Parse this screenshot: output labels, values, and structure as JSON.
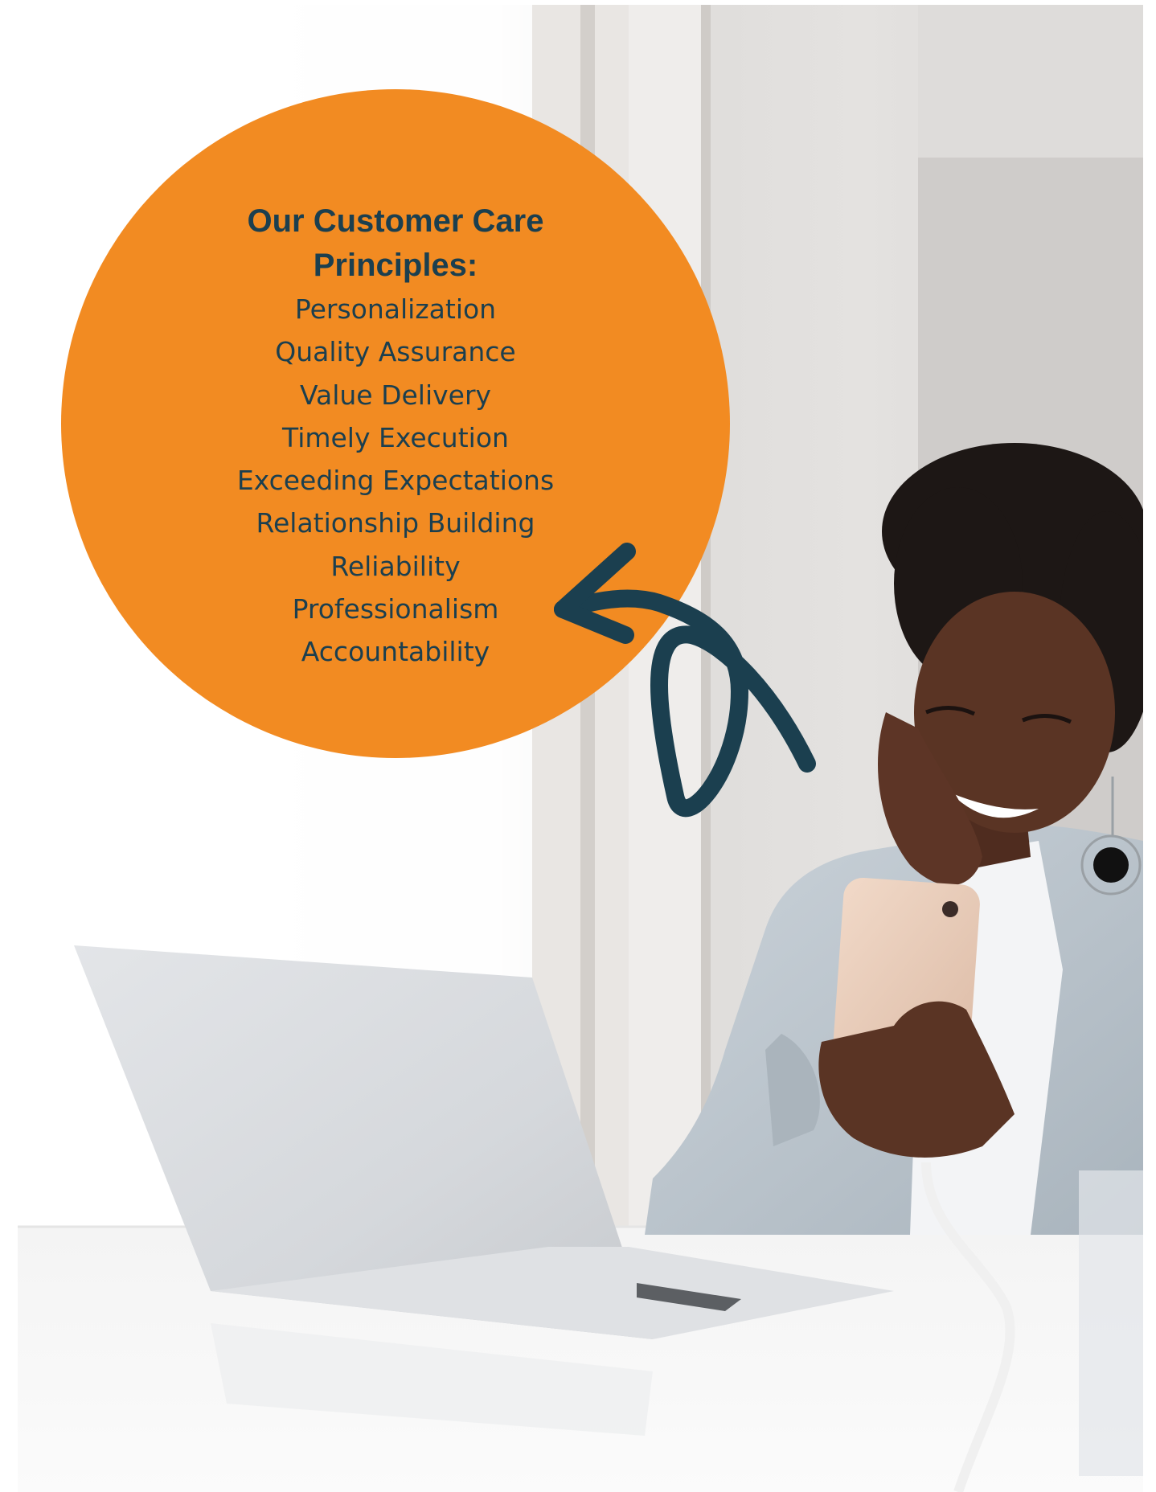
{
  "colors": {
    "accent_orange": "#f28b22",
    "dark_teal": "#1b3f4f",
    "skin": "#5a3424",
    "blazer": "#b9c3cb"
  },
  "card": {
    "heading_line1": "Our Customer Care",
    "heading_line2": "Principles:",
    "principles": [
      "Personalization",
      "Quality Assurance",
      "Value Delivery",
      "Timely Execution",
      "Exceeding Expectations",
      "Relationship Building",
      "Reliability",
      "Professionalism",
      "Accountability"
    ]
  },
  "icons": {
    "arrow": "curved-arrow-icon"
  }
}
